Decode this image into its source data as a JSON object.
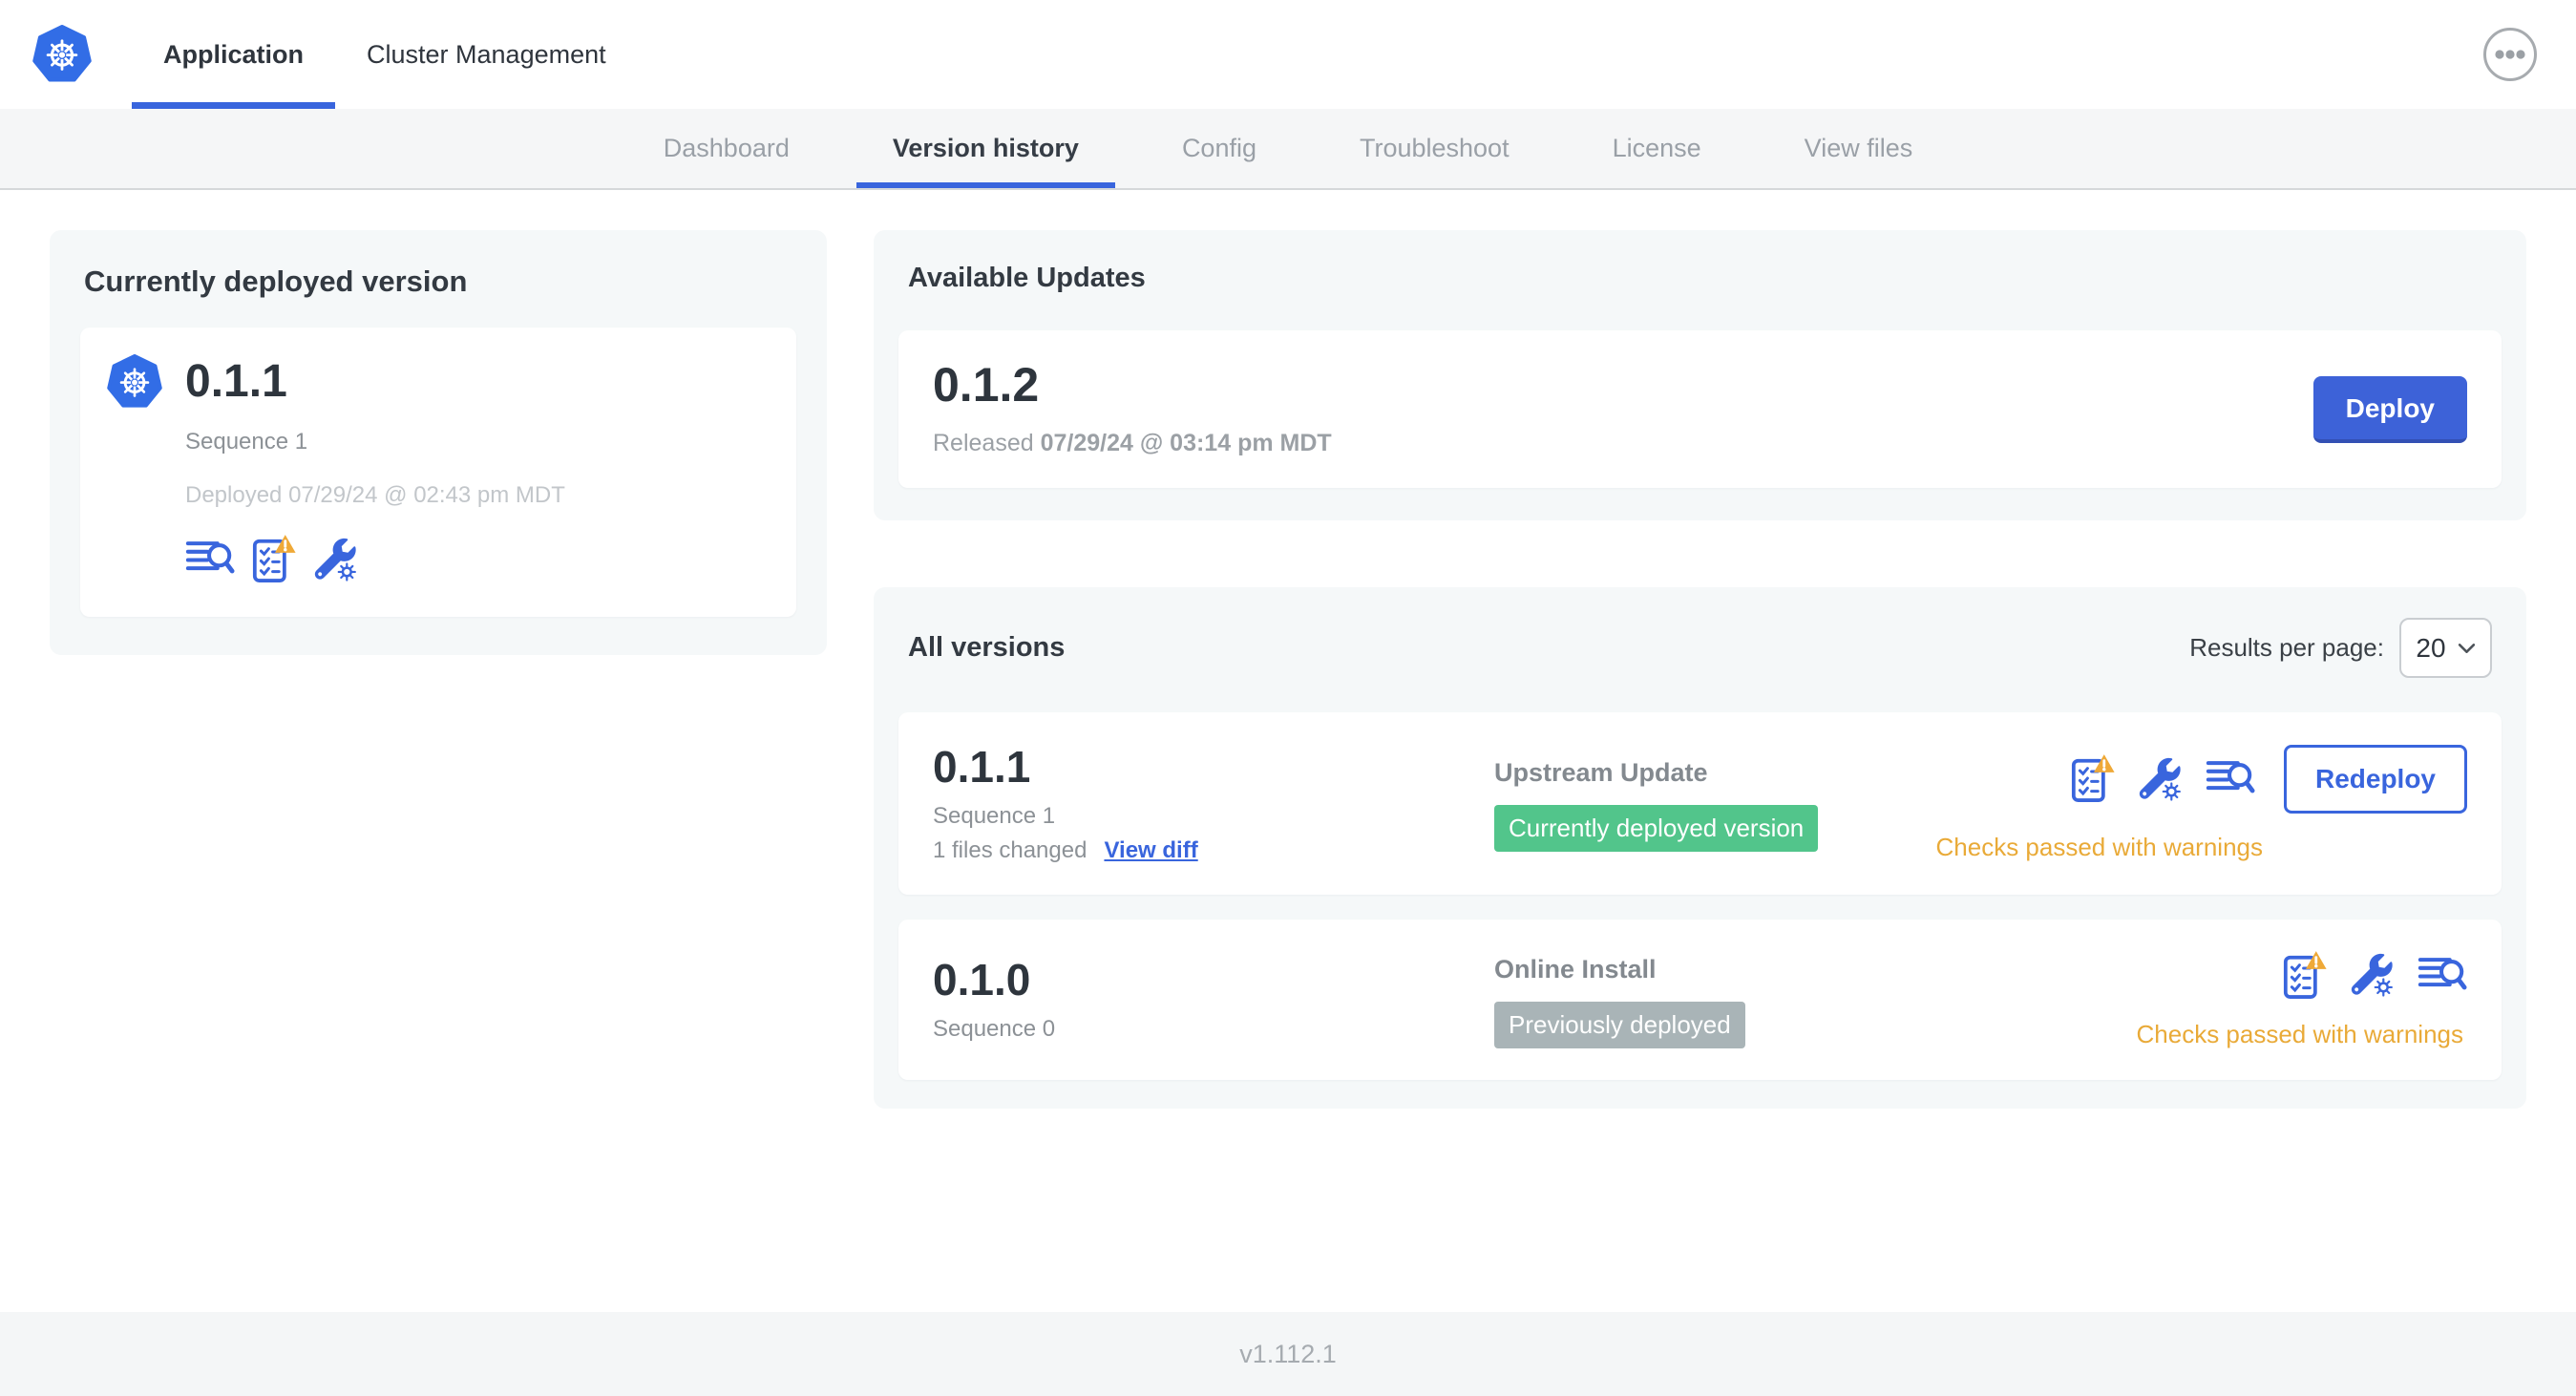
{
  "header": {
    "tabs": [
      {
        "label": "Application",
        "active": true
      },
      {
        "label": "Cluster Management",
        "active": false
      }
    ]
  },
  "subnav": {
    "items": [
      {
        "label": "Dashboard",
        "active": false
      },
      {
        "label": "Version history",
        "active": true
      },
      {
        "label": "Config",
        "active": false
      },
      {
        "label": "Troubleshoot",
        "active": false
      },
      {
        "label": "License",
        "active": false
      },
      {
        "label": "View files",
        "active": false
      }
    ]
  },
  "current_version_card": {
    "title": "Currently deployed version",
    "version": "0.1.1",
    "sequence": "Sequence 1",
    "deployed": "Deployed 07/29/24 @ 02:43 pm MDT",
    "icons": [
      "diff-icon",
      "preflight-checks-warning-icon",
      "config-icon"
    ]
  },
  "available_updates": {
    "title": "Available Updates",
    "version": "0.1.2",
    "released_prefix": "Released",
    "released_date": "07/29/24 @ 03:14 pm MDT",
    "deploy_label": "Deploy"
  },
  "all_versions": {
    "title": "All versions",
    "results_per_page_label": "Results per page:",
    "results_per_page_value": "20",
    "rows": [
      {
        "version": "0.1.1",
        "sequence": "Sequence 1",
        "files_changed": "1 files changed",
        "view_diff_label": "View diff",
        "source": "Upstream Update",
        "badge": "Currently deployed version",
        "badge_color": "green",
        "status": "Checks passed with warnings",
        "action_label": "Redeploy",
        "icons": [
          "preflight-checks-warning-icon",
          "config-icon",
          "diff-icon"
        ]
      },
      {
        "version": "0.1.0",
        "sequence": "Sequence 0",
        "source": "Online Install",
        "badge": "Previously deployed",
        "badge_color": "gray",
        "status": "Checks passed with warnings",
        "icons": [
          "preflight-checks-warning-icon",
          "config-icon",
          "diff-icon"
        ]
      }
    ]
  },
  "footer": {
    "app_version": "v1.112.1"
  },
  "colors": {
    "accent_blue": "#3965dd",
    "kubernetes_blue": "#326de6",
    "deploy_button": "#3d62d8",
    "badge_green": "#52c58b",
    "badge_gray": "#a9b4b7",
    "warning_amber": "#e9aa38",
    "card_background": "#f5f8f9"
  }
}
